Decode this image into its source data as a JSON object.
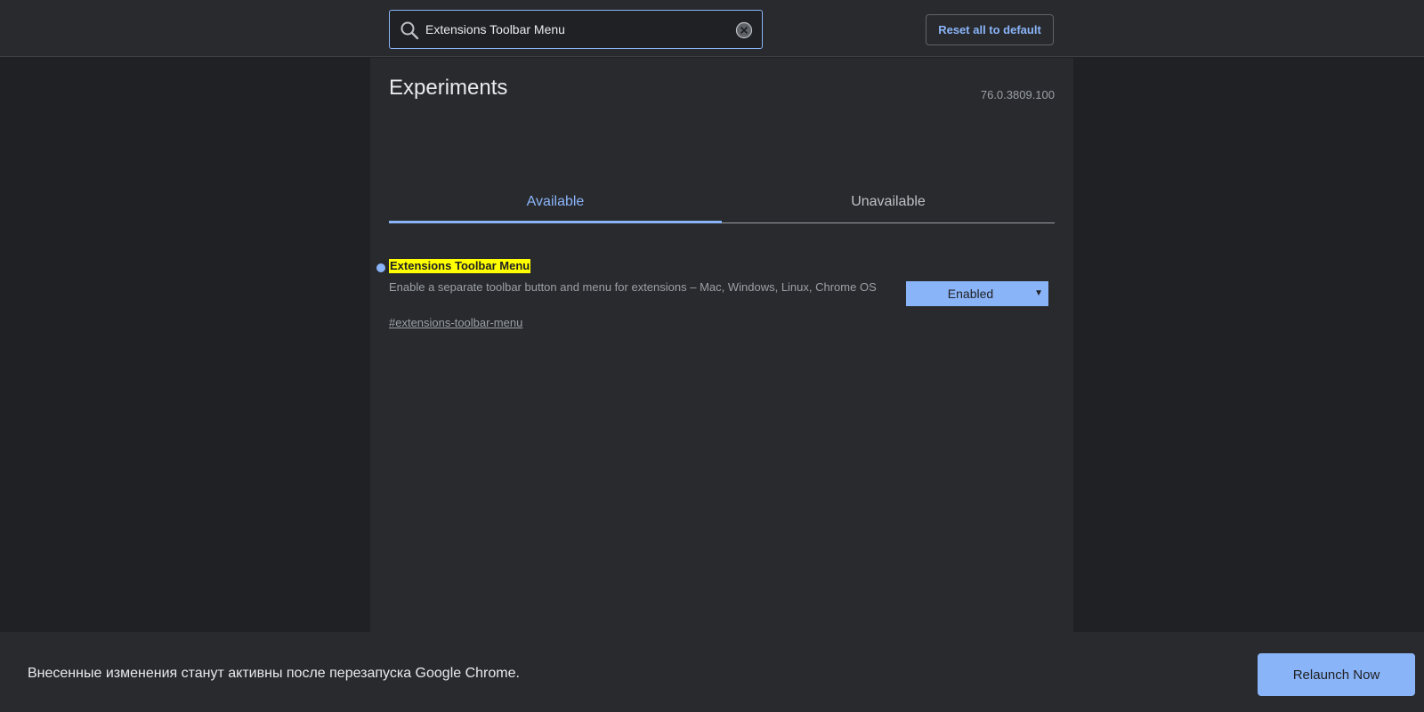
{
  "header": {
    "search": {
      "value": "Extensions Toolbar Menu",
      "icon": "search-icon",
      "clear_icon": "clear-icon"
    },
    "reset_label": "Reset all to default"
  },
  "main": {
    "title": "Experiments",
    "version": "76.0.3809.100",
    "tabs": [
      {
        "label": "Available",
        "selected": true
      },
      {
        "label": "Unavailable",
        "selected": false
      }
    ],
    "experiments": [
      {
        "title": "Extensions Toolbar Menu",
        "description": "Enable a separate toolbar button and menu for extensions – Mac, Windows, Linux, Chrome OS",
        "link": "#extensions-toolbar-menu",
        "value": "Enabled"
      }
    ]
  },
  "footer": {
    "message": "Внесенные изменения станут активны после перезапуска Google Chrome.",
    "relaunch_label": "Relaunch Now"
  },
  "colors": {
    "background": "#202124",
    "panel": "#292a2d",
    "accent": "#8ab4f8",
    "highlight": "#ffff00",
    "text_primary": "#e8eaed",
    "text_secondary": "#9aa0a6"
  }
}
